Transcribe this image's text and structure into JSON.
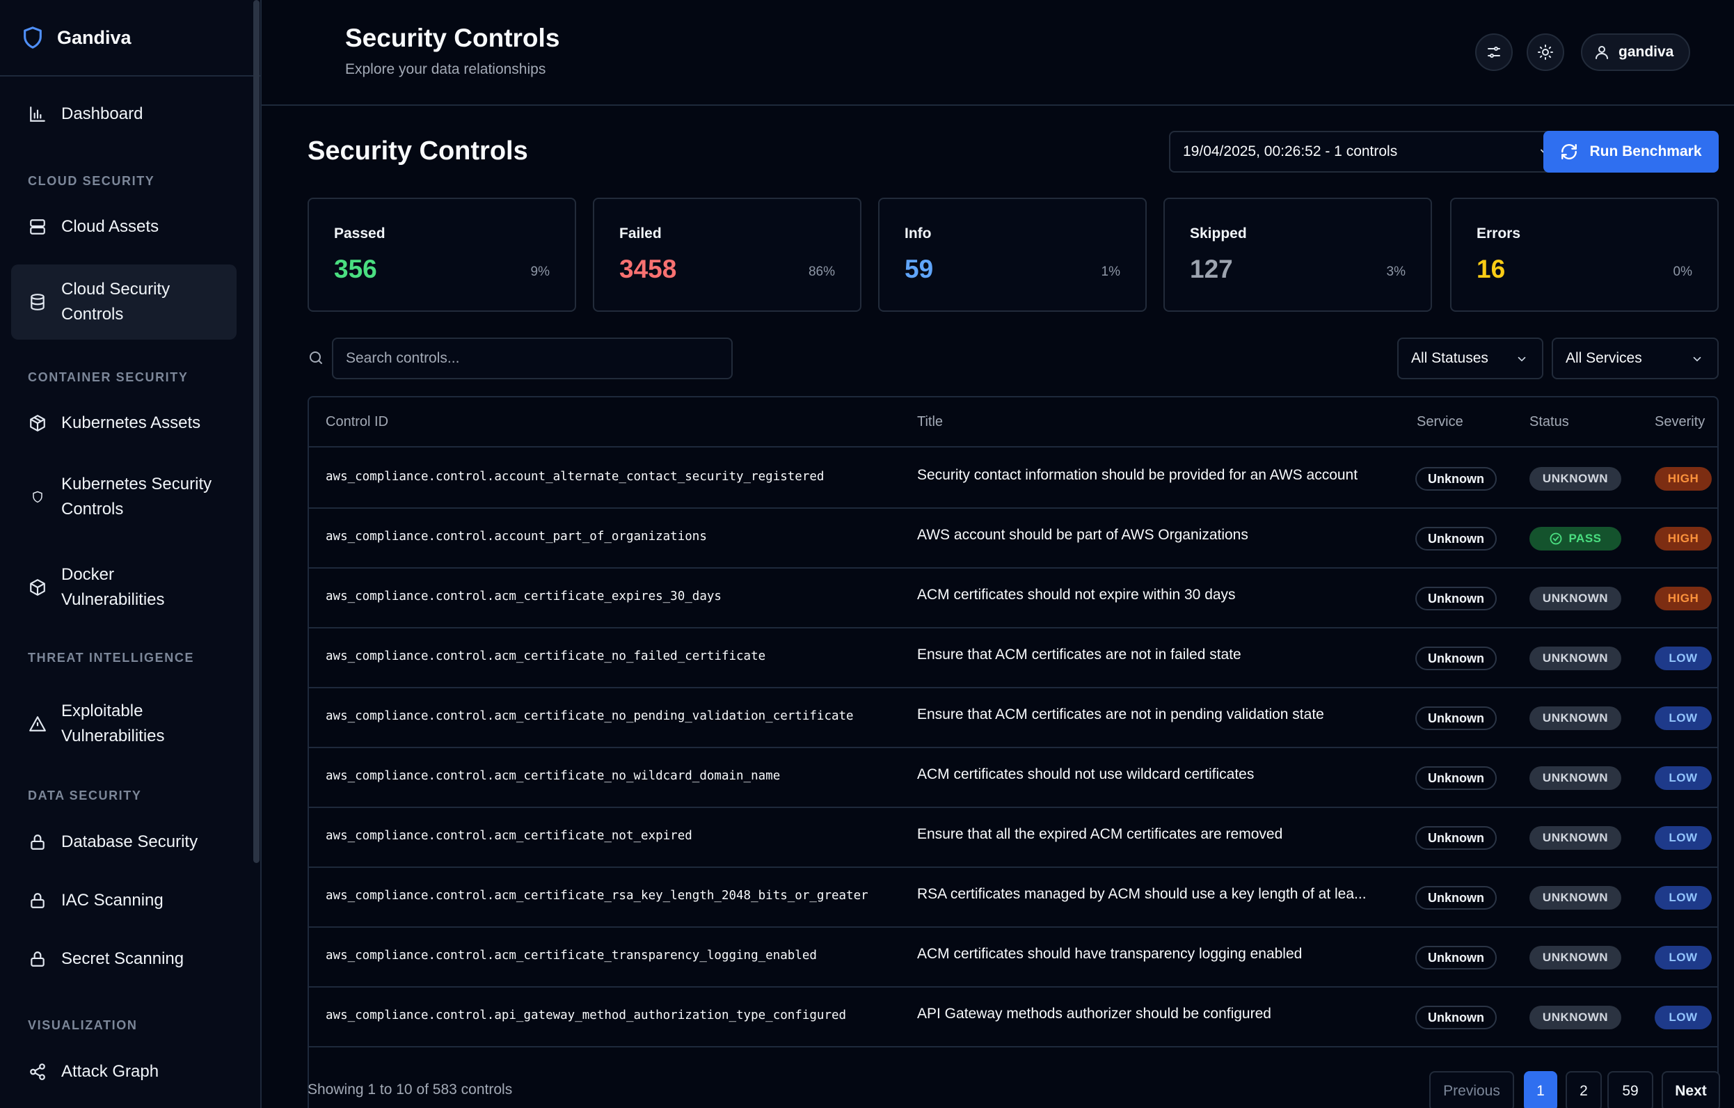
{
  "brand": {
    "name": "Gandiva"
  },
  "sidebar": {
    "items": [
      {
        "label": "Dashboard",
        "icon": "bar-chart-icon"
      },
      {
        "section": "CLOUD SECURITY"
      },
      {
        "label": "Cloud Assets",
        "icon": "server-icon"
      },
      {
        "label": "Cloud Security Controls",
        "icon": "database-icon",
        "active": true
      },
      {
        "section": "CONTAINER SECURITY"
      },
      {
        "label": "Kubernetes Assets",
        "icon": "boxes-icon"
      },
      {
        "label": "Kubernetes Security Controls",
        "icon": "hexagon-icon"
      },
      {
        "label": "Docker Vulnerabilities",
        "icon": "box-icon"
      },
      {
        "section": "THREAT INTELLIGENCE"
      },
      {
        "label": "Exploitable Vulnerabilities",
        "icon": "alert-triangle-icon"
      },
      {
        "section": "DATA SECURITY"
      },
      {
        "label": "Database Security",
        "icon": "lock-icon"
      },
      {
        "label": "IAC Scanning",
        "icon": "lock-icon"
      },
      {
        "label": "Secret Scanning",
        "icon": "lock-icon"
      },
      {
        "section": "VISUALIZATION"
      },
      {
        "label": "Attack Graph",
        "icon": "share-icon"
      }
    ]
  },
  "header": {
    "title": "Security Controls",
    "subtitle": "Explore your data relationships",
    "user": "gandiva"
  },
  "main": {
    "title": "Security Controls",
    "run_selector": "19/04/2025, 00:26:52 - 1 controls",
    "run_button": "Run Benchmark",
    "stats": [
      {
        "label": "Passed",
        "value": "356",
        "pct": "9%",
        "color": "#4ade80"
      },
      {
        "label": "Failed",
        "value": "3458",
        "pct": "86%",
        "color": "#f87171"
      },
      {
        "label": "Info",
        "value": "59",
        "pct": "1%",
        "color": "#60a5fa"
      },
      {
        "label": "Skipped",
        "value": "127",
        "pct": "3%",
        "color": "#9ca3af"
      },
      {
        "label": "Errors",
        "value": "16",
        "pct": "0%",
        "color": "#facc15"
      }
    ],
    "search_placeholder": "Search controls...",
    "status_filter": "All Statuses",
    "service_filter": "All Services",
    "columns": [
      "Control ID",
      "Title",
      "Service",
      "Status",
      "Severity"
    ],
    "rows": [
      {
        "id": "aws_compliance.control.account_alternate_contact_security_registered",
        "title": "Security contact information should be provided for an AWS account",
        "service": "Unknown",
        "status": "UNKNOWN",
        "severity": "HIGH"
      },
      {
        "id": "aws_compliance.control.account_part_of_organizations",
        "title": "AWS account should be part of AWS Organizations",
        "service": "Unknown",
        "status": "PASS",
        "severity": "HIGH"
      },
      {
        "id": "aws_compliance.control.acm_certificate_expires_30_days",
        "title": "ACM certificates should not expire within 30 days",
        "service": "Unknown",
        "status": "UNKNOWN",
        "severity": "HIGH"
      },
      {
        "id": "aws_compliance.control.acm_certificate_no_failed_certificate",
        "title": "Ensure that ACM certificates are not in failed state",
        "service": "Unknown",
        "status": "UNKNOWN",
        "severity": "LOW"
      },
      {
        "id": "aws_compliance.control.acm_certificate_no_pending_validation_certificate",
        "title": "Ensure that ACM certificates are not in pending validation state",
        "service": "Unknown",
        "status": "UNKNOWN",
        "severity": "LOW"
      },
      {
        "id": "aws_compliance.control.acm_certificate_no_wildcard_domain_name",
        "title": "ACM certificates should not use wildcard certificates",
        "service": "Unknown",
        "status": "UNKNOWN",
        "severity": "LOW"
      },
      {
        "id": "aws_compliance.control.acm_certificate_not_expired",
        "title": "Ensure that all the expired ACM certificates are removed",
        "service": "Unknown",
        "status": "UNKNOWN",
        "severity": "LOW"
      },
      {
        "id": "aws_compliance.control.acm_certificate_rsa_key_length_2048_bits_or_greater",
        "title": "RSA certificates managed by ACM should use a key length of at lea...",
        "service": "Unknown",
        "status": "UNKNOWN",
        "severity": "LOW"
      },
      {
        "id": "aws_compliance.control.acm_certificate_transparency_logging_enabled",
        "title": "ACM certificates should have transparency logging enabled",
        "service": "Unknown",
        "status": "UNKNOWN",
        "severity": "LOW"
      },
      {
        "id": "aws_compliance.control.api_gateway_method_authorization_type_configured",
        "title": "API Gateway methods authorizer should be configured",
        "service": "Unknown",
        "status": "UNKNOWN",
        "severity": "LOW"
      }
    ],
    "footer_text": "Showing 1 to 10 of 583 controls",
    "pagination": {
      "previous": "Previous",
      "pages": [
        "1",
        "2",
        "59"
      ],
      "next": "Next"
    }
  }
}
